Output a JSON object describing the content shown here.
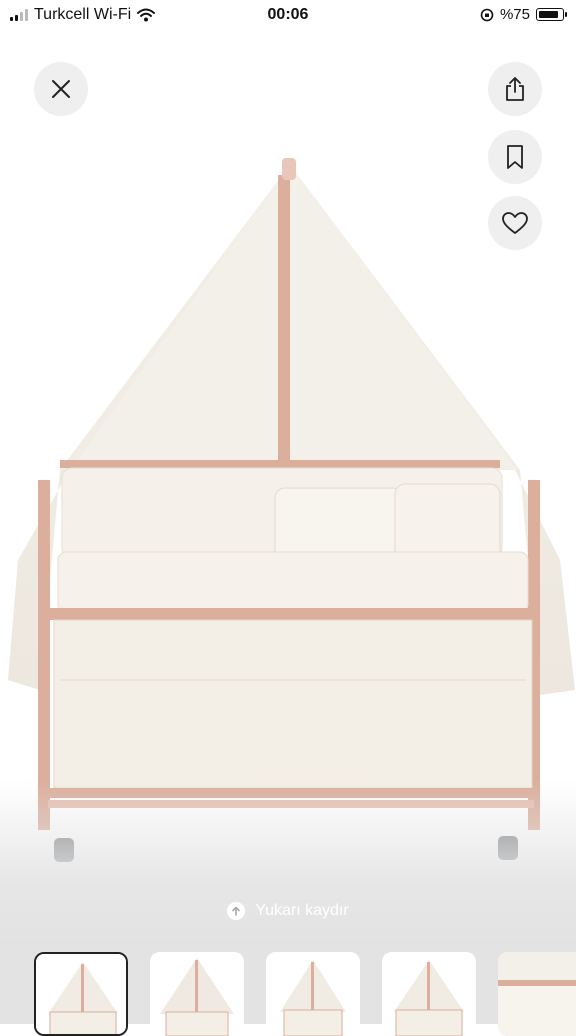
{
  "status_bar": {
    "carrier": "Turkcell Wi-Fi",
    "time": "00:06",
    "battery_percent": "%75",
    "battery_level": 0.75
  },
  "actions": {
    "close_icon": "close-icon",
    "share_icon": "share-icon",
    "bookmark_icon": "bookmark-icon",
    "favorite_icon": "heart-icon"
  },
  "scroll_hint": {
    "label": "Yukarı kaydır",
    "icon": "arrow-up-icon"
  },
  "thumbnails": {
    "count": 5,
    "selected_index": 0
  },
  "colors": {
    "frame_pink": "#dcae9c",
    "fabric_cream": "#f4efe6",
    "button_bg": "#efefef"
  }
}
